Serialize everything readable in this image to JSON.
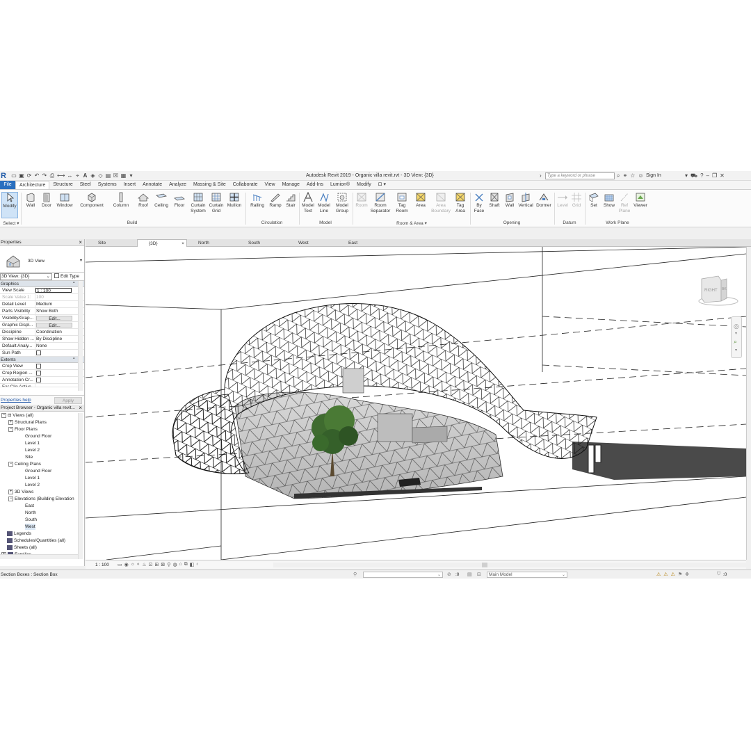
{
  "titlebar": {
    "title": "Autodesk Revit 2019 - Organic villa revit.rvt - 3D View: {3D}",
    "search_placeholder": "Type a keyword or phrase",
    "sign_in": "Sign In"
  },
  "menu_tabs": [
    "File",
    "Architecture",
    "Structure",
    "Steel",
    "Systems",
    "Insert",
    "Annotate",
    "Analyze",
    "Massing & Site",
    "Collaborate",
    "View",
    "Manage",
    "Add-Ins",
    "Lumion®",
    "Modify"
  ],
  "ribbon": {
    "select": {
      "modify": "Modify",
      "group": "Select ▾"
    },
    "build": {
      "buttons": [
        "Wall",
        "Door",
        "Window",
        "Component",
        "Column",
        "Roof",
        "Ceiling",
        "Floor",
        "Curtain System",
        "Curtain Grid",
        "Mullion"
      ],
      "group": "Build"
    },
    "circulation": {
      "buttons": [
        "Railing",
        "Ramp",
        "Stair"
      ],
      "group": "Circulation"
    },
    "model": {
      "buttons": [
        "Model Text",
        "Model Line",
        "Model Group"
      ],
      "group": "Model"
    },
    "room_area": {
      "buttons": [
        "Room",
        "Room Separator",
        "Tag Room",
        "Area",
        "Area Boundary",
        "Tag Area"
      ],
      "group": "Room & Area ▾"
    },
    "opening": {
      "buttons": [
        "By Face",
        "Shaft",
        "Wall",
        "Vertical",
        "Dormer"
      ],
      "group": "Opening"
    },
    "datum": {
      "buttons": [
        "Level",
        "Grid"
      ],
      "group": "Datum"
    },
    "work_plane": {
      "buttons": [
        "Set",
        "Show",
        "Ref Plane",
        "Viewer"
      ],
      "group": "Work Plane"
    }
  },
  "properties": {
    "title": "Properties",
    "type_name": "3D View",
    "view_selector": "3D View: {3D}",
    "edit_type": "Edit Type",
    "section_graphics": "Graphics",
    "rows": [
      {
        "key": "View Scale",
        "value": "1 : 100"
      },
      {
        "key": "Scale Value    1:",
        "value": "100"
      },
      {
        "key": "Detail Level",
        "value": "Medium"
      },
      {
        "key": "Parts Visibility",
        "value": "Show Both"
      },
      {
        "key": "Visibility/Grap...",
        "value": "Edit..."
      },
      {
        "key": "Graphic Displ...",
        "value": "Edit..."
      },
      {
        "key": "Discipline",
        "value": "Coordination"
      },
      {
        "key": "Show Hidden ...",
        "value": "By Discipline"
      },
      {
        "key": "Default Analy...",
        "value": "None"
      },
      {
        "key": "Sun Path",
        "value": ""
      }
    ],
    "section_extents": "Extents",
    "extent_rows": [
      "Crop View",
      "Crop Region ...",
      "Annotation Cr...",
      "Far Clip Active"
    ],
    "help": "Properties help",
    "apply": "Apply"
  },
  "browser": {
    "title": "Project Browser - Organic villa revit...",
    "items": [
      "Views (all)",
      "Structural Plans",
      "Floor Plans",
      "Ground Floor",
      "Level 1",
      "Level 2",
      "Site",
      "Ceiling Plans",
      "Ground Floor",
      "Level 1",
      "Level 2",
      "3D Views",
      "Elevations (Building Elevation",
      "East",
      "North",
      "South",
      "West",
      "Legends",
      "Schedules/Quantities (all)",
      "Sheets (all)",
      "Families"
    ]
  },
  "view_tabs": [
    "Site",
    "{3D}",
    "North",
    "South",
    "West",
    "East"
  ],
  "viewcube": {
    "face_right": "RIGHT",
    "face_back": "BK"
  },
  "viewbar": {
    "scale": "1 : 100"
  },
  "statusbar": {
    "status": "Section Boxes : Section Box",
    "zero": ":0",
    "model": "Main Model",
    "filter": ":0"
  }
}
